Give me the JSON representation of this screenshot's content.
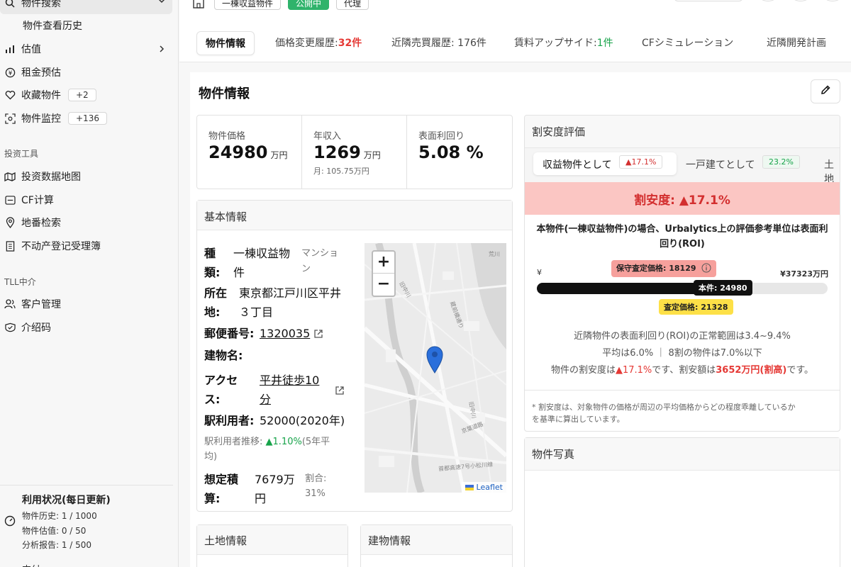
{
  "sidebar": {
    "items": [
      {
        "label": "物件搜索",
        "icon": "search-icon"
      },
      {
        "label": "物件查看历史"
      },
      {
        "label": "估值",
        "icon": "bar-chart-icon"
      },
      {
        "label": "租金预估",
        "icon": "yen-circle-icon"
      },
      {
        "label": "收藏物件",
        "icon": "heart-icon",
        "badge": "+2"
      },
      {
        "label": "物件监控",
        "icon": "monitor-icon",
        "badge": "+136"
      }
    ],
    "section_tools": "投资工具",
    "tools": [
      {
        "label": "投资数据地图",
        "icon": "map-data-icon"
      },
      {
        "label": "CF计算",
        "icon": "calculator-icon"
      },
      {
        "label": "地番检索",
        "icon": "pin-icon"
      },
      {
        "label": "不动产登记受理簿",
        "icon": "register-icon"
      }
    ],
    "section_tll": "TLL中介",
    "tll": [
      {
        "label": "客户管理",
        "icon": "users-icon"
      },
      {
        "label": "介绍码",
        "icon": "ticket-icon"
      }
    ],
    "usage": {
      "title": "利用状况(每日更新)",
      "lines": [
        "物件历史: 1 / 1000",
        "物件估值: 0 / 50",
        "分析报告: 1 / 500"
      ],
      "footer": "支付"
    }
  },
  "header_tags": [
    "一棟収益物件",
    "公開中",
    "代理"
  ],
  "tabs": [
    {
      "label": "物件情報"
    },
    {
      "label": "価格変更履歴:",
      "count": "32件"
    },
    {
      "label": "近隣売買履歴: 176件"
    },
    {
      "label": "賃料アップサイド:",
      "count": "1件"
    },
    {
      "label": "CFシミュレーション"
    },
    {
      "label": "近隣開発計画"
    }
  ],
  "property": {
    "title": "物件情報",
    "metrics": [
      {
        "label": "物件価格",
        "value": "24980",
        "unit": "万円"
      },
      {
        "label": "年収入",
        "value": "1269",
        "unit": "万円",
        "sub": "月: 105.75万円"
      },
      {
        "label": "表面利回り",
        "value": "5.08 %"
      }
    ],
    "basic_title": "基本情報",
    "basic": {
      "type_key_1": "種",
      "type_key_2": "類:",
      "type_val_1": "一棟収益物",
      "type_val_2": "件",
      "type_tag_1": "マンショ",
      "type_tag_2": "ン",
      "addr_key_1": "所在",
      "addr_key_2": "地:",
      "addr_val_1": "東京都江戸川区平井",
      "addr_val_2": "３丁目",
      "zip_key": "郵便番号:",
      "zip_val": "1320035",
      "bldg_key": "建物名:",
      "access_key_1": "アクセ",
      "access_key_2": "ス:",
      "access_val_1": "平井徒歩10",
      "access_val_2": "分",
      "station_key": "駅利用者:",
      "station_val": "52000(2020年)",
      "trend_label": "駅利用者推移:",
      "trend_val": "▲1.10%",
      "trend_tail_1": "(5年平",
      "trend_tail_2": "均)",
      "est_key_1": "想定積",
      "est_key_2": "算:",
      "est_val_1": "7679万",
      "est_val_2": "円",
      "ratio_1": "割合:",
      "ratio_2": "31%"
    },
    "land_title": "土地情報",
    "building_title": "建物情報"
  },
  "map": {
    "zoom_in": "+",
    "zoom_out": "−",
    "attribution": "Leaflet",
    "labels": [
      "荒川",
      "旧中川",
      "京葉道路",
      "首都高速7号小松川線",
      "蔵前橋通り",
      "旧中川"
    ]
  },
  "discount": {
    "title": "割安度評価",
    "tab1": "収益物件として",
    "tab1_pill": "▲17.1%",
    "tab2": "一戸建てとして",
    "tab2_pill": "23.2%",
    "tab3": "土地",
    "banner": "割安度: ▲17.1%",
    "desc_1": "本物件(一棟収益物件)の場合、Urbalytics上の評価参考単位は表面利",
    "desc_2": "回り(ROI)",
    "conservative": "保守査定価格: 18129",
    "max_price": "¥37323万円",
    "this_property": "本件: 24980",
    "assessed": "査定価格: 21328",
    "min_mark": "¥",
    "bar": {
      "min": 0,
      "max": 37323,
      "conservative": 18129,
      "assessed": 21328,
      "this": 24980
    },
    "note1": "近隣物件の表面利回り(ROI)の正常範囲は3.4~9.4%",
    "note2": "平均は6.0%  ｜ 8割の物件は7.0%以下",
    "note3a": "物件の割安度は",
    "note3b": "▲17.1%",
    "note3c": "です、割安額は",
    "note3d": "3652万円(割高)",
    "note3e": "です。",
    "footnote_1": "* 割安度は、対象物件の価格が周辺の平均価格からどの程度乖離しているか",
    "footnote_2": "を基準に算出しています。"
  },
  "photos_title": "物件写真"
}
